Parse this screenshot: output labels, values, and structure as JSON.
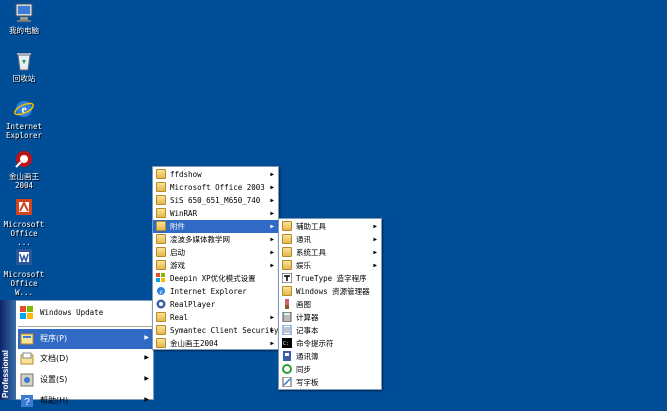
{
  "desktop": {
    "icons": [
      {
        "label": "我的电脑",
        "icon": "computer-icon"
      },
      {
        "label": "回收站",
        "icon": "recycle-bin-icon"
      },
      {
        "label": "Internet\nExplorer",
        "icon": "ie-icon"
      },
      {
        "label": "金山画王\n2004",
        "icon": "kingsoft-icon"
      },
      {
        "label": "Microsoft\nOffice ...",
        "icon": "office-icon"
      },
      {
        "label": "Microsoft\nOffice W...",
        "icon": "office-word-icon"
      }
    ]
  },
  "start_menu": {
    "sidebar_text": "Professional",
    "top_item": {
      "label": "Windows Update",
      "icon": "windows-update-icon"
    },
    "items": [
      {
        "label": "程序(P)",
        "icon": "programs-icon",
        "has_submenu": true,
        "selected": true
      },
      {
        "label": "文档(D)",
        "icon": "documents-icon",
        "has_submenu": true
      },
      {
        "label": "设置(S)",
        "icon": "settings-icon",
        "has_submenu": true
      },
      {
        "label": "帮助(H)",
        "icon": "help-icon",
        "has_submenu": true
      }
    ]
  },
  "programs_menu": {
    "items": [
      {
        "label": "ffdshow",
        "icon": "folder-icon",
        "has_submenu": true
      },
      {
        "label": "Microsoft Office 2003",
        "icon": "folder-icon",
        "has_submenu": true
      },
      {
        "label": "SiS 650_651_M650_740",
        "icon": "folder-icon",
        "has_submenu": true
      },
      {
        "label": "WinRAR",
        "icon": "folder-icon",
        "has_submenu": true
      },
      {
        "label": "附件",
        "icon": "folder-icon",
        "has_submenu": true,
        "selected": true
      },
      {
        "label": "凌波多媒体教学网",
        "icon": "folder-icon",
        "has_submenu": true
      },
      {
        "label": "启动",
        "icon": "folder-icon",
        "has_submenu": true
      },
      {
        "label": "游戏",
        "icon": "folder-icon",
        "has_submenu": true
      },
      {
        "label": "Deepin XP优化模式设置",
        "icon": "deepin-icon",
        "has_submenu": false
      },
      {
        "label": "Internet Explorer",
        "icon": "ie-icon",
        "has_submenu": false
      },
      {
        "label": "RealPlayer",
        "icon": "realplayer-icon",
        "has_submenu": false
      },
      {
        "label": "Real",
        "icon": "folder-icon",
        "has_submenu": true
      },
      {
        "label": "Symantec Client Security",
        "icon": "folder-icon",
        "has_submenu": true
      },
      {
        "label": "金山画王2004",
        "icon": "folder-icon",
        "has_submenu": true
      }
    ]
  },
  "accessories_menu": {
    "items": [
      {
        "label": "辅助工具",
        "icon": "folder-icon",
        "has_submenu": true
      },
      {
        "label": "通讯",
        "icon": "folder-icon",
        "has_submenu": true
      },
      {
        "label": "系统工具",
        "icon": "folder-icon",
        "has_submenu": true
      },
      {
        "label": "娱乐",
        "icon": "folder-icon",
        "has_submenu": true
      },
      {
        "label": "TrueType 造字程序",
        "icon": "truetype-icon",
        "has_submenu": false
      },
      {
        "label": "Windows 资源管理器",
        "icon": "explorer-icon",
        "has_submenu": false
      },
      {
        "label": "画图",
        "icon": "paint-icon",
        "has_submenu": false
      },
      {
        "label": "计算器",
        "icon": "calculator-icon",
        "has_submenu": false
      },
      {
        "label": "记事本",
        "icon": "notepad-icon",
        "has_submenu": false
      },
      {
        "label": "命令提示符",
        "icon": "cmd-icon",
        "has_submenu": false
      },
      {
        "label": "通讯簿",
        "icon": "addressbook-icon",
        "has_submenu": false
      },
      {
        "label": "同步",
        "icon": "sync-icon",
        "has_submenu": false
      },
      {
        "label": "写字板",
        "icon": "wordpad-icon",
        "has_submenu": false
      }
    ]
  }
}
